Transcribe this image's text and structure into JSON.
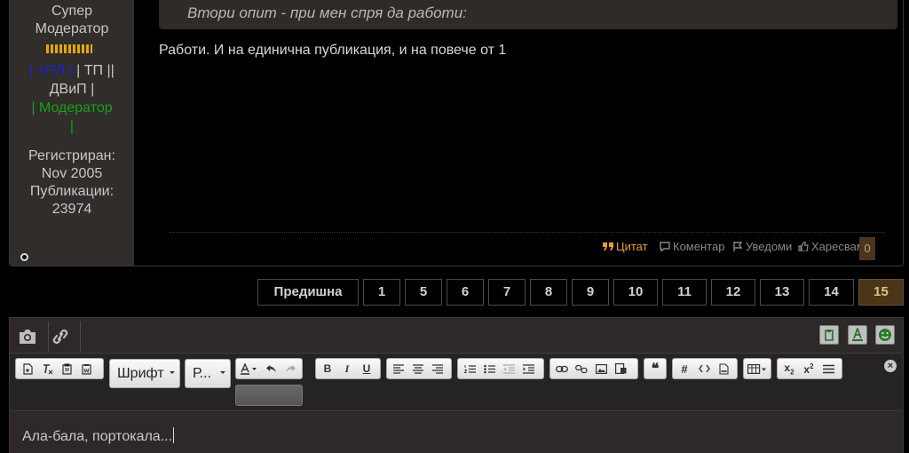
{
  "author": {
    "rank_line1": "Супер",
    "rank_line2": "Модератор",
    "group_blue": "| +ПЛ |",
    "group_tp": "| ТП ||",
    "group_dvip": "ДВиП |",
    "group_mod": "| Модератор",
    "group_end": "|",
    "registered_label": "Регистриран:",
    "registered_value": "Nov 2005",
    "posts_label": "Публикации:",
    "posts_value": "23974"
  },
  "post": {
    "quote_text": "Втори опит - при мен спря да работи:",
    "body": "Работи. И на единична публикация, и на повече от 1",
    "actions": {
      "quote": "Цитат",
      "comment": "Коментар",
      "notify": "Уведоми",
      "like": "Харесвам",
      "like_count": "0"
    }
  },
  "pagination": {
    "prev": "Предишна",
    "pages": [
      "1",
      "5",
      "6",
      "7",
      "8",
      "9",
      "10",
      "11",
      "12",
      "13",
      "14",
      "15"
    ],
    "current": "15"
  },
  "editor": {
    "font_combo": "Шрифт",
    "size_combo": "Р...",
    "text": "Ала-бала, портокала..."
  },
  "colors": {
    "accent": "#e6a030",
    "active_page_bg": "#4a3519",
    "sidebar_bg": "#302d2b"
  }
}
